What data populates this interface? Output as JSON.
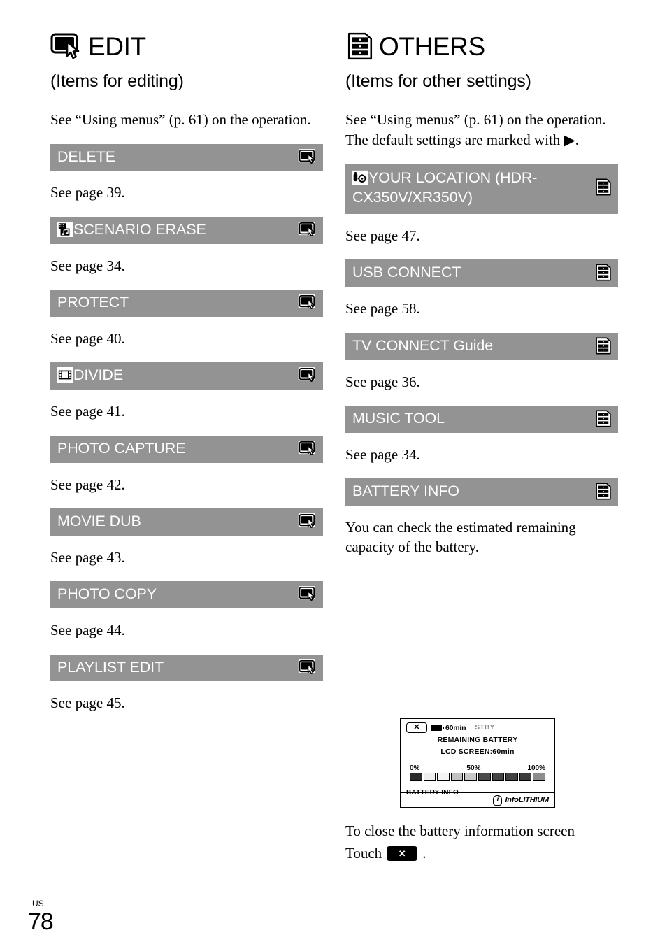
{
  "page": {
    "folio_region": "US",
    "folio_number": "78"
  },
  "colors": {
    "bar_gray": "#939393",
    "bar_text": "#ffffff",
    "page_bg": "#ffffff",
    "ink": "#000000"
  },
  "left_column": {
    "icon_name": "edit-screen-cursor-icon",
    "title": "EDIT",
    "subtitle": "(Items for editing)",
    "intro": "See “Using menus” (p. 61) on the operation.",
    "items": [
      {
        "label": "DELETE",
        "prefix_icon": null,
        "right_icon": "edit-screen-cursor-icon",
        "see": "See page 39."
      },
      {
        "label": "SCENARIO ERASE",
        "prefix_icon": "film-music-icon",
        "right_icon": "edit-screen-cursor-icon",
        "see": "See page 34."
      },
      {
        "label": "PROTECT",
        "prefix_icon": null,
        "right_icon": "edit-screen-cursor-icon",
        "see": "See page 40."
      },
      {
        "label": "DIVIDE",
        "prefix_icon": "film-strip-icon",
        "right_icon": "edit-screen-cursor-icon",
        "see": "See page 41."
      },
      {
        "label": "PHOTO CAPTURE",
        "prefix_icon": null,
        "right_icon": "edit-screen-cursor-icon",
        "see": "See page 42."
      },
      {
        "label": "MOVIE DUB",
        "prefix_icon": null,
        "right_icon": "edit-screen-cursor-icon",
        "see": "See page 43."
      },
      {
        "label": "PHOTO COPY",
        "prefix_icon": null,
        "right_icon": "edit-screen-cursor-icon",
        "see": "See page 44."
      },
      {
        "label": "PLAYLIST EDIT",
        "prefix_icon": null,
        "right_icon": "edit-screen-cursor-icon",
        "see": "See page 45."
      }
    ]
  },
  "right_column": {
    "icon_name": "others-document-icon",
    "title": "OTHERS",
    "subtitle": "(Items for other settings)",
    "intro_line1": "See “Using menus” (p. 61) on the operation.",
    "intro_line2": "The default settings are marked with ▶.",
    "items": [
      {
        "label": "YOUR LOCATION (HDR-CX350V/XR350V)",
        "prefix_icon": "gps-location-icon",
        "right_icon": "others-document-icon",
        "see": "See page 47.",
        "two_line": true
      },
      {
        "label": "USB CONNECT",
        "prefix_icon": null,
        "right_icon": "others-document-icon",
        "see": "See page 58."
      },
      {
        "label": "TV CONNECT Guide",
        "prefix_icon": null,
        "right_icon": "others-document-icon",
        "see": "See page 36."
      },
      {
        "label": "MUSIC TOOL",
        "prefix_icon": null,
        "right_icon": "others-document-icon",
        "see": "See page 34."
      },
      {
        "label": "BATTERY INFO",
        "prefix_icon": null,
        "right_icon": "others-document-icon",
        "see": "You can check the estimated remaining capacity of the battery.",
        "two_line_body": true
      }
    ],
    "battery_screen": {
      "close_button_label": "✕",
      "battery_time": "60min",
      "status": "STBY",
      "heading": "REMAINING BATTERY",
      "lcd_line": "LCD SCREEN:60min",
      "scale_min": "0%",
      "scale_mid": "50%",
      "scale_max": "100%",
      "segments": [
        "#2b2b2b",
        "#efefef",
        "#f4f4f4",
        "#c2c2c2",
        "#c8c8c8",
        "#4a4a4a",
        "#444444",
        "#414141",
        "#3d3d3d",
        "#8d8d8d"
      ],
      "footer_label": "BATTERY INFO",
      "logo_badge": "i",
      "logo_text": "InfoLITHIUM"
    },
    "closing_line1": "To close the battery information screen",
    "closing_touch_word": "Touch",
    "closing_button_icon": "close-x-button",
    "closing_period": "."
  }
}
